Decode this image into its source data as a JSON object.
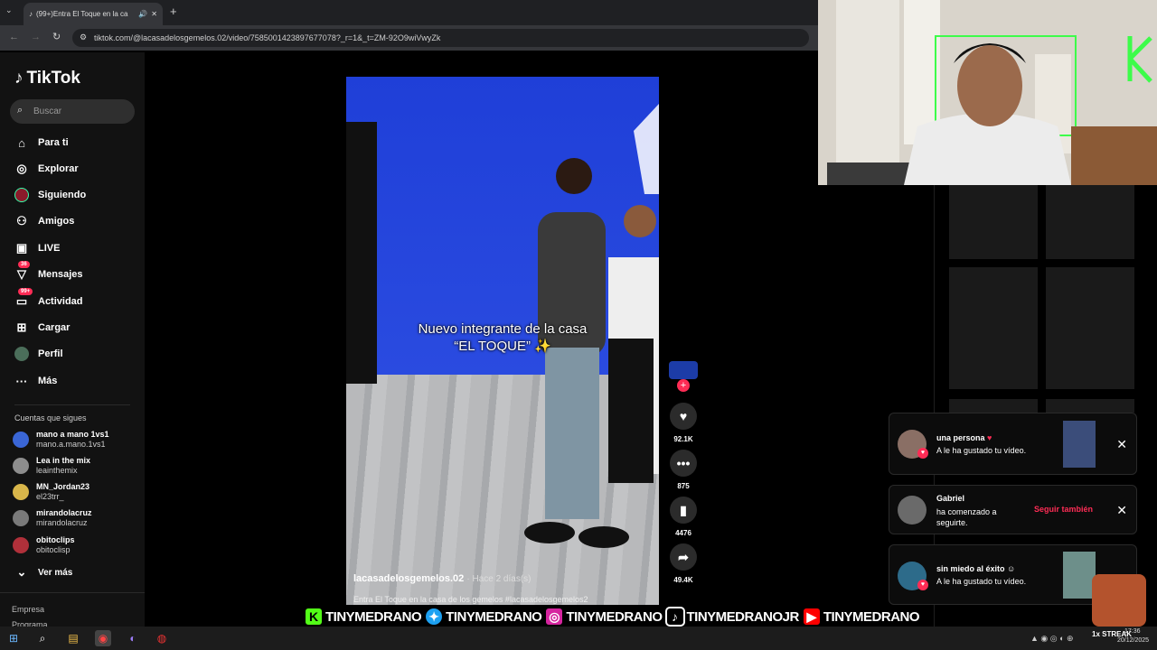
{
  "browser": {
    "tab_title": "(99+)Entra El Toque en la ca",
    "url": "tiktok.com/@lacasadelosgemelos.02/video/7585001423897677078?_r=1&_t=ZM-92O9wiVwyZk"
  },
  "sidebar": {
    "logo": "TikTok",
    "search_placeholder": "Buscar",
    "nav": [
      {
        "label": "Para ti",
        "icon": "home-icon"
      },
      {
        "label": "Explorar",
        "icon": "compass-icon"
      },
      {
        "label": "Siguiendo",
        "icon": "following-icon"
      },
      {
        "label": "Amigos",
        "icon": "friends-icon"
      },
      {
        "label": "LIVE",
        "icon": "live-icon"
      },
      {
        "label": "Mensajes",
        "icon": "messages-icon",
        "badge": "36"
      },
      {
        "label": "Actividad",
        "icon": "activity-icon",
        "badge": "99+"
      },
      {
        "label": "Cargar",
        "icon": "upload-icon"
      },
      {
        "label": "Perfil",
        "icon": "profile-icon"
      },
      {
        "label": "Más",
        "icon": "more-icon"
      }
    ],
    "following_title": "Cuentas que sigues",
    "following": [
      {
        "name": "mano a mano 1vs1",
        "handle": "mano.a.mano.1vs1",
        "color": "#3a66d6"
      },
      {
        "name": "Lea in the mix",
        "handle": "leainthemix",
        "color": "#8d8d8d"
      },
      {
        "name": "MN_Jordan23",
        "handle": "el23trr_",
        "color": "#d8b64a"
      },
      {
        "name": "mirandolacruz",
        "handle": "mirandolacruz",
        "color": "#7a7a7a"
      },
      {
        "name": "obitoclips",
        "handle": "obitoclisp",
        "color": "#b0303a"
      }
    ],
    "see_more": "Ver más",
    "footer": [
      "Empresa",
      "Programa"
    ]
  },
  "video": {
    "caption_line1": "Nuevo integrante de la casa",
    "caption_line2": "“EL TOQUE” ✨",
    "author": "lacasadelosgemelos.02",
    "time": "· Hace 2 días(s)",
    "description": "Entra El Toque en la casa de los gemelos #lacasadelosgemelos2"
  },
  "actions": {
    "likes": "92.1K",
    "comments": "875",
    "saves": "4476",
    "shares": "49.4K"
  },
  "notifications": [
    {
      "title": "una persona",
      "body": "A le ha gustado tu vídeo.",
      "avatar_color": "#8a6f65"
    },
    {
      "title": "Gabriel",
      "body": "ha comenzado a seguirte.",
      "action": "Seguir también",
      "avatar_color": "#6a6a6a"
    },
    {
      "title": "sin miedo al éxito",
      "body": "A le ha gustado tu vídeo.",
      "avatar_color": "#2d6b8a"
    }
  ],
  "social": [
    {
      "platform": "kick",
      "handle": "TINYMEDRANO",
      "color": "#53fc18"
    },
    {
      "platform": "twitter",
      "handle": "TINYMEDRANO",
      "color": "#1da1f2"
    },
    {
      "platform": "instagram",
      "handle": "TINYMEDRANO",
      "color": "#d6249f"
    },
    {
      "platform": "tiktok",
      "handle": "TINYMEDRANOJR",
      "color": "#000000"
    },
    {
      "platform": "youtube",
      "handle": "TINYMEDRANO",
      "color": "#ff0000"
    }
  ],
  "taskbar": {
    "time": "17:36",
    "date": "20/12/2025",
    "overlay_text": "1x STREAK"
  },
  "colors": {
    "accent": "#fe2c55",
    "background": "#000000"
  }
}
